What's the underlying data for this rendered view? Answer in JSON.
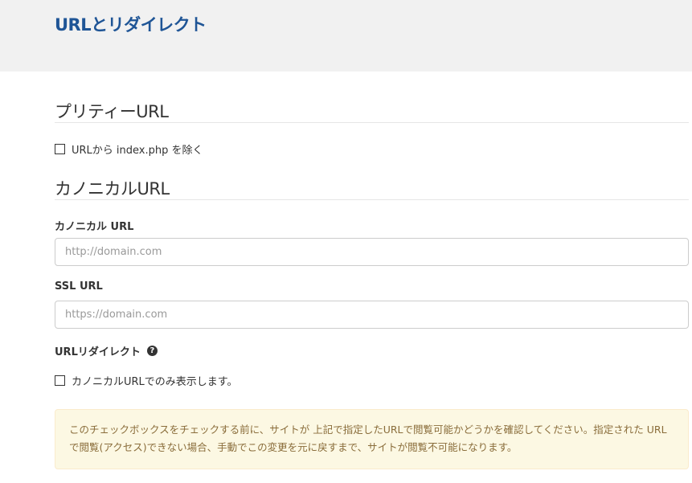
{
  "header": {
    "title": "URLとリダイレクト"
  },
  "pretty_url": {
    "heading": "プリティーURL",
    "remove_index_label": "URLから index.php を除く",
    "remove_index_checked": false
  },
  "canonical": {
    "heading": "カノニカルURL",
    "canonical_url_label": "カノニカル URL",
    "canonical_url_placeholder": "http://domain.com",
    "canonical_url_value": "",
    "ssl_url_label": "SSL URL",
    "ssl_url_placeholder": "https://domain.com",
    "ssl_url_value": "",
    "redirect_label": "URLリダイレクト",
    "help_icon": "question-circle-icon",
    "canonical_only_label": "カノニカルURLでのみ表示します。",
    "canonical_only_checked": false,
    "warning": "このチェックボックスをチェックする前に、サイトが 上記で指定したURLで閲覧可能かどうかを確認してください。指定された URLで閲覧(アクセス)できない場合、手動でこの変更を元に戻すまで、サイトが閲覧不可能になります。"
  },
  "colors": {
    "title": "#1f5596",
    "header_bg": "#f1f1f1",
    "alert_bg": "#fcf8e3",
    "alert_text": "#8a6d3b"
  }
}
